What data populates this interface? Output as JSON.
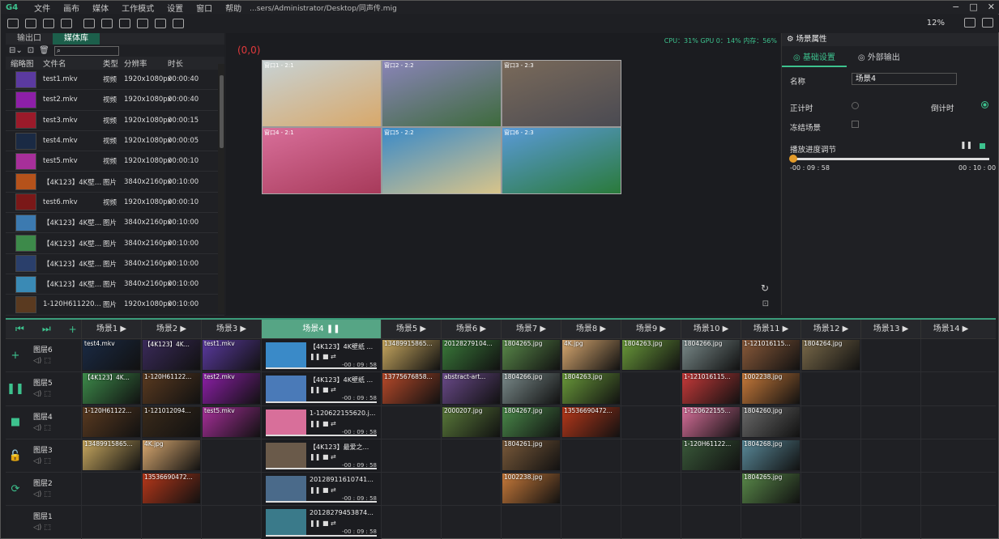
{
  "titlebar": {
    "logo": "G4",
    "menu": [
      "文件",
      "画布",
      "媒体",
      "工作模式",
      "设置",
      "窗口",
      "帮助"
    ],
    "path": "...sers/Administrator/Desktop/同声传.mig",
    "controls": [
      "−",
      "□",
      "✕"
    ]
  },
  "toolbar": {
    "zoom": "12%"
  },
  "media": {
    "tabs": [
      "输出口",
      "媒体库"
    ],
    "columns": [
      "缩略图",
      "文件名",
      "类型",
      "分辨率",
      "时长"
    ],
    "items": [
      {
        "name": "test1.mkv",
        "type": "视频",
        "res": "1920x1080px",
        "dur": "00:00:40",
        "color": "#5b3aa0"
      },
      {
        "name": "test2.mkv",
        "type": "视频",
        "res": "1920x1080px",
        "dur": "00:00:40",
        "color": "#8d1fa8"
      },
      {
        "name": "test3.mkv",
        "type": "视频",
        "res": "1920x1080px",
        "dur": "00:00:15",
        "color": "#9b1a2a"
      },
      {
        "name": "test4.mkv",
        "type": "视频",
        "res": "1920x1080px",
        "dur": "00:00:05",
        "color": "#1a2a44"
      },
      {
        "name": "test5.mkv",
        "type": "视频",
        "res": "1920x1080px",
        "dur": "00:00:10",
        "color": "#a72f9a"
      },
      {
        "name": "【4K123】4K壁纸 (9)...",
        "type": "图片",
        "res": "3840x2160px",
        "dur": "00:10:00",
        "color": "#b5521b"
      },
      {
        "name": "test6.mkv",
        "type": "视频",
        "res": "1920x1080px",
        "dur": "00:00:10",
        "color": "#7a1818"
      },
      {
        "name": "【4K123】4K壁纸 (1...",
        "type": "图片",
        "res": "3840x2160px",
        "dur": "00:10:00",
        "color": "#3c7ab0"
      },
      {
        "name": "【4K123】4K壁纸 (1...",
        "type": "图片",
        "res": "3840x2160px",
        "dur": "00:10:00",
        "color": "#3d8a4a"
      },
      {
        "name": "【4K123】4K壁纸 (1...",
        "type": "图片",
        "res": "3840x2160px",
        "dur": "00:10:00",
        "color": "#2a3f6b"
      },
      {
        "name": "【4K123】4K壁纸 (1...",
        "type": "图片",
        "res": "3840x2160px",
        "dur": "00:10:00",
        "color": "#3a8ab5"
      },
      {
        "name": "1-120H6112208.jpg",
        "type": "图片",
        "res": "1920x1080px",
        "dur": "00:10:00",
        "color": "#5a3a20"
      }
    ]
  },
  "preview": {
    "origin": "(0,0)",
    "stats": "CPU：31%  GPU 0：14%  内存：56%",
    "windows": [
      {
        "label": "窗口1 - 2:1",
        "color1": "#c7d2d4",
        "color2": "#d8a86a"
      },
      {
        "label": "窗口2 - 2:2",
        "color1": "#8a84b8",
        "color2": "#3e6b3d"
      },
      {
        "label": "窗口3 - 2:3",
        "color1": "#7a6a5a",
        "color2": "#4a4a52"
      },
      {
        "label": "窗口4 - 2:1",
        "color1": "#d86f9a",
        "color2": "#a73a5a"
      },
      {
        "label": "窗口5 - 2:2",
        "color1": "#3a8ac8",
        "color2": "#d8c48a"
      },
      {
        "label": "窗口6 - 2:3",
        "color1": "#5a9ad8",
        "color2": "#2a7a3a"
      }
    ]
  },
  "props": {
    "header": "场景属性",
    "tabs": [
      "基础设置",
      "外部输出"
    ],
    "name_label": "名称",
    "name_value": "场景4",
    "countup": "正计时",
    "countdown": "倒计时",
    "freeze": "冻结场景",
    "progress_label": "播放进度调节",
    "elapsed": "-00 : 09 : 58",
    "total": "00 : 10 : 00",
    "progress": 0.003
  },
  "timeline": {
    "scenes": [
      "场景1 ▶",
      "场景2 ▶",
      "场景3 ▶",
      "场景4 ❚❚",
      "场景5 ▶",
      "场景6 ▶",
      "场景7 ▶",
      "场景8 ▶",
      "场景9 ▶",
      "场景10 ▶",
      "场景11 ▶",
      "场景12 ▶",
      "场景13 ▶",
      "场景14 ▶"
    ],
    "layers": [
      {
        "name": "图层6",
        "btn": "+",
        "clips": [
          {
            "c": "test4.mkv",
            "col": "#1a2a44"
          },
          {
            "c": "【4K123】4K...",
            "col": "#3a2a5a"
          },
          {
            "c": "test1.mkv",
            "col": "#5b3aa0"
          },
          {
            "big": "【4K123】4K壁纸 ...",
            "t": "-00 : 09 : 58",
            "col": "#3a8ac8"
          },
          {
            "c": "13489915865...",
            "col": "#c8a860"
          },
          {
            "c": "20128279104...",
            "col": "#3a7a3a"
          },
          {
            "c": "1804265.jpg",
            "col": "#5a8a4a"
          },
          {
            "c": "4K.jpg",
            "col": "#d8a870"
          },
          {
            "c": "1804263.jpg",
            "col": "#6a9a3a"
          },
          {
            "c": "1804266.jpg",
            "col": "#7a8a8a"
          },
          {
            "c": "1-121016115...",
            "col": "#8a5a3a"
          },
          {
            "c": "1804264.jpg",
            "col": "#7a6a4a"
          },
          {},
          {}
        ]
      },
      {
        "name": "图层5",
        "btn": "❚❚",
        "clips": [
          {
            "c": "【4K123】4K...",
            "col": "#3d8a4a"
          },
          {
            "c": "1-120H61122...",
            "col": "#5a3a20"
          },
          {
            "c": "test2.mkv",
            "col": "#8d1fa8"
          },
          {
            "big": "【4K123】4K壁纸 ...",
            "t": "-00 : 09 : 58",
            "col": "#4a7ab8"
          },
          {
            "c": "13775676858...",
            "col": "#b84a2a"
          },
          {
            "c": "abstract-art...",
            "col": "#6a4a8a"
          },
          {
            "c": "1804266.jpg",
            "col": "#7a8a8a"
          },
          {
            "c": "1804263.jpg",
            "col": "#6a9a3a"
          },
          {},
          {
            "c": "1-121016115...",
            "col": "#c83a3a"
          },
          {
            "c": "1002238.jpg",
            "col": "#c87a3a"
          },
          {},
          {},
          {}
        ]
      },
      {
        "name": "图层4",
        "btn": "■",
        "clips": [
          {
            "c": "1-120H61122...",
            "col": "#5a3a20"
          },
          {
            "c": "1-121012094...",
            "col": "#3a2a1a"
          },
          {
            "c": "test5.mkv",
            "col": "#a72f9a"
          },
          {
            "big": "1-120622155620.j...",
            "t": "-00 : 09 : 58",
            "col": "#d86f9a"
          },
          {},
          {
            "c": "2000207.jpg",
            "col": "#5a7a3a"
          },
          {
            "c": "1804267.jpg",
            "col": "#4a8a4a"
          },
          {
            "c": "13536690472...",
            "col": "#b8381a"
          },
          {},
          {
            "c": "1-120622155...",
            "col": "#d86f9a"
          },
          {
            "c": "1804260.jpg",
            "col": "#6a6a6a"
          },
          {},
          {},
          {}
        ]
      },
      {
        "name": "图层3",
        "btn": "🔓",
        "clips": [
          {
            "c": "13489915865...",
            "col": "#c8a860"
          },
          {
            "c": "4K.jpg",
            "col": "#d8a870"
          },
          {},
          {
            "big": "【4K123】最爱之...",
            "t": "-00 : 09 : 58",
            "col": "#6a5a4a"
          },
          {},
          {},
          {
            "c": "1804261.jpg",
            "col": "#7a5a3a"
          },
          {},
          {},
          {
            "c": "1-120H61122...",
            "col": "#3a5a3a"
          },
          {
            "c": "1804268.jpg",
            "col": "#5a8a9a"
          },
          {},
          {},
          {}
        ]
      },
      {
        "name": "图层2",
        "btn": "⟳",
        "clips": [
          {},
          {
            "c": "13536690472...",
            "col": "#b8381a"
          },
          {},
          {
            "big": "20128911610741...",
            "t": "-00 : 09 : 58",
            "col": "#4a6a8a"
          },
          {},
          {},
          {
            "c": "1002238.jpg",
            "col": "#c87a3a"
          },
          {},
          {},
          {},
          {
            "c": "1804265.jpg",
            "col": "#5a8a4a"
          },
          {},
          {},
          {}
        ]
      },
      {
        "name": "图层1",
        "btn": "",
        "clips": [
          {},
          {},
          {},
          {
            "big": "20128279453874...",
            "t": "-00 : 09 : 58",
            "col": "#3a7a8a"
          },
          {},
          {},
          {},
          {},
          {},
          {},
          {},
          {},
          {},
          {}
        ]
      }
    ]
  }
}
